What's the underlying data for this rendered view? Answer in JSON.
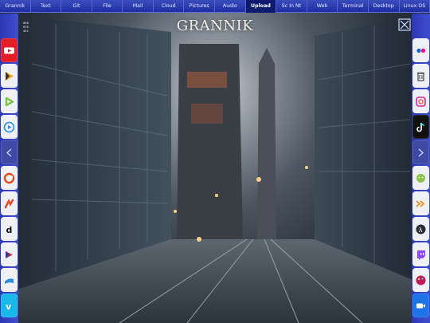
{
  "topbar": {
    "tabs": [
      {
        "label": "Grannik",
        "active": false
      },
      {
        "label": "Text",
        "active": false
      },
      {
        "label": "Git",
        "active": false
      },
      {
        "label": "File",
        "active": false
      },
      {
        "label": "Mail",
        "active": false
      },
      {
        "label": "Cloud",
        "active": false
      },
      {
        "label": "Pictures",
        "active": false
      },
      {
        "label": "Audio",
        "active": false
      },
      {
        "label": "Upload",
        "active": true
      },
      {
        "label": "Sc In Nt",
        "active": false
      },
      {
        "label": "Web",
        "active": false
      },
      {
        "label": "Terminal",
        "active": false
      },
      {
        "label": "Desktop",
        "active": false
      },
      {
        "label": "Linux OS",
        "active": false
      }
    ]
  },
  "clock": {
    "time": "00:00:00",
    "col2": [
      "000",
      "630",
      "461"
    ]
  },
  "logo": "GRANNIK",
  "corner_buttons": {
    "left": "close-box-icon",
    "right": "settings-gear-icon"
  },
  "left_apps": [
    {
      "name": "youtube-icon",
      "bg": "#e41e26"
    },
    {
      "name": "play-music-icon",
      "bg": "#eef0f6"
    },
    {
      "name": "rumble-icon",
      "bg": "#eef0f6"
    },
    {
      "name": "vlc-play-icon",
      "bg": "#eef0f6"
    },
    {
      "name": "collapse-left-icon",
      "bg": "#3e4aa4"
    },
    {
      "name": "crunchyroll-icon",
      "bg": "#eef0f6"
    },
    {
      "name": "deezer-icon",
      "bg": "#eef0f6"
    },
    {
      "name": "dailymotion-icon",
      "bg": "#eef0f6"
    },
    {
      "name": "prime-video-icon",
      "bg": "#eef0f6"
    },
    {
      "name": "zoom-wave-icon",
      "bg": "#eef0f6"
    },
    {
      "name": "vimeo-icon",
      "bg": "#1ab7ea"
    }
  ],
  "right_apps": [
    {
      "name": "flickr-icon",
      "bg": "#eef0f6"
    },
    {
      "name": "trash-icon",
      "bg": "#eef0f6"
    },
    {
      "name": "instagram-icon",
      "bg": "#eef0f6"
    },
    {
      "name": "tiktok-icon",
      "bg": "#111111"
    },
    {
      "name": "collapse-right-icon",
      "bg": "#3e4aa4"
    },
    {
      "name": "android-icon",
      "bg": "#eef0f6"
    },
    {
      "name": "forward-arrows-icon",
      "bg": "#eef0f6"
    },
    {
      "name": "lambda-icon",
      "bg": "#eef0f6"
    },
    {
      "name": "twitch-icon",
      "bg": "#eef0f6"
    },
    {
      "name": "paint-icon",
      "bg": "#eef0f6"
    },
    {
      "name": "video-camera-icon",
      "bg": "#1e73e8"
    }
  ],
  "colors": {
    "bar_blue": "#1e2ea3",
    "side_blue": "#3f4ed0",
    "active_tab": "#0e1a6e"
  }
}
